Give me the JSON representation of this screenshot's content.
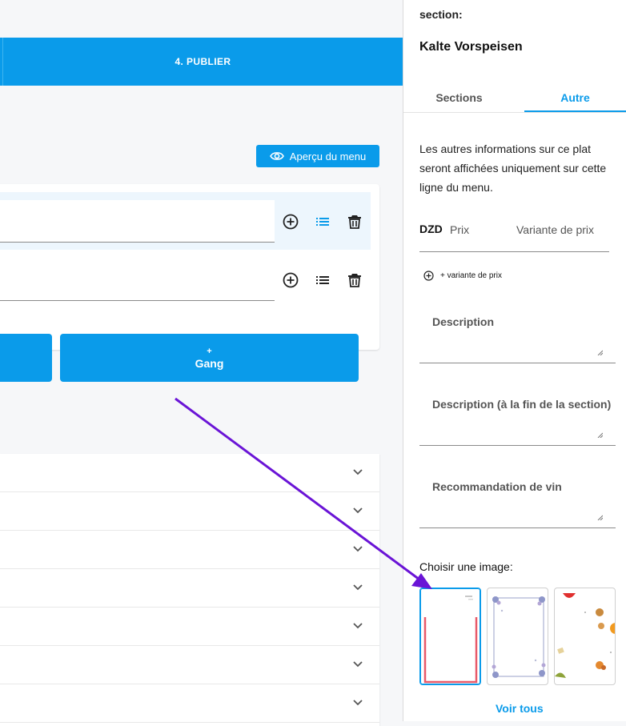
{
  "stepper": {
    "step4_label": "4. PUBLIER"
  },
  "toolbar": {
    "preview_label": "Aperçu du menu"
  },
  "add_buttons": {
    "right_plus": "+",
    "right_label": "Gang"
  },
  "accordion_rows": 7,
  "panel": {
    "section_label": "section:",
    "section_name": "Kalte Vorspeisen",
    "tabs": {
      "sections": "Sections",
      "other": "Autre"
    },
    "info_text": "Les autres informations sur ce plat seront affichées uniquement sur cette ligne du menu.",
    "currency": "DZD",
    "price_placeholder": "Prix",
    "variant_placeholder": "Variante de prix",
    "add_variant_label": "+ variante de prix",
    "description_label": "Description",
    "description_end_label": "Description (à la fin de la section)",
    "wine_label": "Recommandation de vin",
    "choose_image_label": "Choisir une image:",
    "see_all_label": "Voir tous"
  },
  "colors": {
    "primary": "#0a9bea",
    "arrow": "#6a14d6"
  },
  "icons": [
    "eye-icon",
    "plus-circle-icon",
    "list-icon",
    "trash-icon",
    "chevron-down-icon"
  ]
}
